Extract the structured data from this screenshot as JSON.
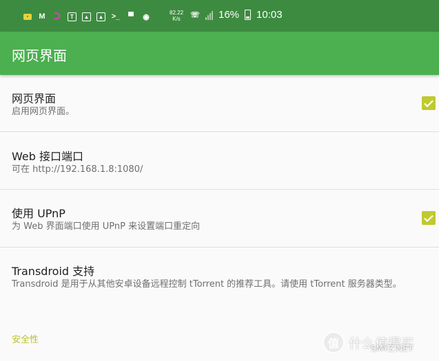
{
  "status_bar": {
    "speed": "82.22",
    "speed_unit": "K/s",
    "battery": "16%",
    "time": "10:03",
    "left_icons": [
      "sim-card-icon",
      "m-icon",
      "magnet-icon",
      "tt-icon",
      "image-icon",
      "image-icon",
      "terminal-icon",
      "router-icon",
      "wifi-icon"
    ],
    "right_icons": [
      "wifi-calling-icon",
      "signal-icon",
      "battery-charging-icon"
    ]
  },
  "toolbar": {
    "title": "网页界面"
  },
  "preferences": [
    {
      "title": "网页界面",
      "summary": "启用网页界面。",
      "checked": true
    },
    {
      "title": "Web 接口端口",
      "summary": "可在 http://192.168.1.8:1080/"
    },
    {
      "title": "使用 UPnP",
      "summary": "为 Web 界面端口使用 UPnP 来设置端口重定向",
      "checked": true
    },
    {
      "title": "Transdroid 支持",
      "summary": "Transdroid 是用于从其他安卓设备远程控制 tTorrent 的推荐工具。请使用 tTorrent 服务器类型。"
    }
  ],
  "category": {
    "label": "安全性"
  },
  "watermark": {
    "logo_text": "值",
    "text": "什么值得买",
    "sub": "SMYZ.NET"
  },
  "colors": {
    "status_bar": "#3d8b40",
    "toolbar": "#4caf50",
    "accent": "#c0c92e",
    "category": "#b9c12a"
  }
}
